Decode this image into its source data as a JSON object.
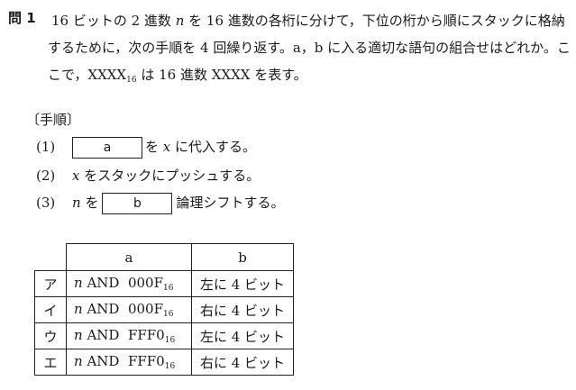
{
  "question": {
    "number": "問 1",
    "line1_pre": "16 ビットの 2 進数 ",
    "var_n": "n",
    "line1_post": " を 16 進数の各桁に分けて，下位の桁から順にスタックに格納",
    "line2": "するために，次の手順を 4 回繰り返す。a，b に入る適切な語句の組合せはどれか。こ",
    "line3_pre": "こで，XXXX",
    "line3_sub": "16",
    "line3_post": " は 16 進数 XXXX を表す。"
  },
  "procedure": {
    "title": "〔手順〕",
    "steps": [
      {
        "num": "(1)",
        "blank": "a",
        "text_after_pre": "を ",
        "var": "x",
        "text_after_post": " に代入する。"
      },
      {
        "num": "(2)",
        "var": "x",
        "text": " をスタックにプッシュする。"
      },
      {
        "num": "(3)",
        "var": "n",
        "text_before": " を",
        "blank": "b",
        "text_after": "論理シフトする。"
      }
    ]
  },
  "table": {
    "headers": {
      "a": "a",
      "b": "b"
    },
    "rows": [
      {
        "label": "ア",
        "a_var": "n",
        "a_op": " AND  000F",
        "a_sub": "16",
        "b": "左に 4 ビット"
      },
      {
        "label": "イ",
        "a_var": "n",
        "a_op": " AND  000F",
        "a_sub": "16",
        "b": "右に 4 ビット"
      },
      {
        "label": "ウ",
        "a_var": "n",
        "a_op": " AND  FFF0",
        "a_sub": "16",
        "b": "左に 4 ビット"
      },
      {
        "label": "エ",
        "a_var": "n",
        "a_op": " AND  FFF0",
        "a_sub": "16",
        "b": "右に 4 ビット"
      }
    ]
  }
}
